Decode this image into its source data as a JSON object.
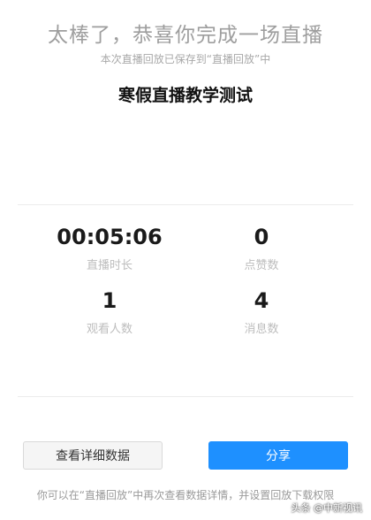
{
  "congrats_text": "太棒了，恭喜你完成一场直播",
  "saved_note": "本次直播回放已保存到“直播回放”中",
  "title": "寒假直播教学测试",
  "stats": [
    {
      "value": "00:05:06",
      "label": "直播时长"
    },
    {
      "value": "0",
      "label": "点赞数"
    },
    {
      "value": "1",
      "label": "观看人数"
    },
    {
      "value": "4",
      "label": "消息数"
    }
  ],
  "buttons": {
    "detail": "查看详细数据",
    "share": "分享"
  },
  "footer_note": "你可以在“直播回放”中再次查看数据详情，并设置回放下载权限",
  "watermark": "头条 @中新视讯",
  "colors": {
    "primary": "#1e90ff",
    "muted": "#9e9e9e"
  }
}
